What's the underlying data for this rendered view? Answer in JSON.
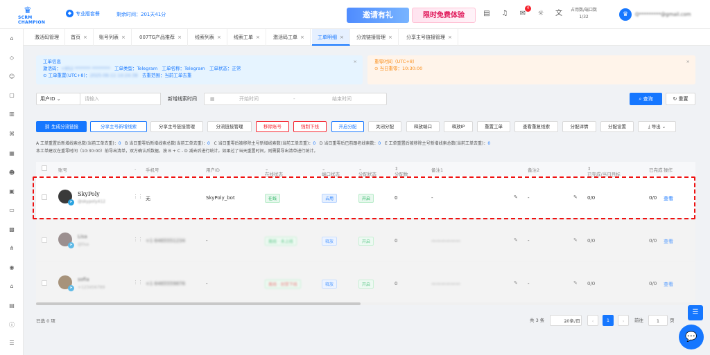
{
  "brand": {
    "line1": "SCRM",
    "line2": "CHAMPION"
  },
  "header": {
    "pro_label": "专业版套餐",
    "remaining_time": "剩余时间：201天41分",
    "banner_invite": "邀请有礼",
    "banner_trial": "限时免费体验",
    "notification_count": "4",
    "usage_label": "占用数/端口数",
    "usage_value": "1/32",
    "user_email": "Q*********@gmail.com"
  },
  "tabs": [
    {
      "label": "激活码管理",
      "closable": false
    },
    {
      "label": "首页",
      "closable": true
    },
    {
      "label": "账号列表",
      "closable": true
    },
    {
      "label": "007TG产品推荐",
      "closable": true
    },
    {
      "label": "线索列表",
      "closable": true
    },
    {
      "label": "线索工单",
      "closable": true
    },
    {
      "label": "激活码工单",
      "closable": true
    },
    {
      "label": "工单明细",
      "closable": true,
      "active": true
    },
    {
      "label": "分流链接管理",
      "closable": true
    },
    {
      "label": "分享主号链接管理",
      "closable": true
    }
  ],
  "info": {
    "title": "工单信息",
    "code_label": "激活码：",
    "type_label": "工单类型：",
    "type_value": "Telegram",
    "name_label": "工单名称：",
    "name_value": "Telegram",
    "status_label": "工单状态：",
    "status_value": "正常",
    "reset_label": "工单重置(UTC+8)：",
    "dedupe_label": "去重范围：",
    "dedupe_value": "当前工单去重"
  },
  "warn": {
    "title": "重零时间（UTC+8）",
    "line": "当日重零：10:30:00"
  },
  "filter": {
    "select_value": "用户ID",
    "input_placeholder": "请输入",
    "time_label": "新增线索时间",
    "start_placeholder": "开始时间",
    "sep": "-",
    "end_placeholder": "结束时间",
    "query": "查询",
    "reset": "重置"
  },
  "actions": [
    {
      "label": "生成分流链接",
      "style": "primary"
    },
    {
      "label": "分享主号新增线索",
      "style": "blue"
    },
    {
      "label": "分享主号链接管理",
      "style": ""
    },
    {
      "label": "分流链接管理",
      "style": ""
    },
    {
      "label": "移除账号",
      "style": "red"
    },
    {
      "label": "强制下线",
      "style": "red"
    },
    {
      "label": "开启分配",
      "style": "blue"
    },
    {
      "label": "关闭分配",
      "style": ""
    },
    {
      "label": "释放端口",
      "style": ""
    },
    {
      "label": "释放IP",
      "style": ""
    },
    {
      "label": "重置工单",
      "style": ""
    },
    {
      "label": "查看重复线索",
      "style": ""
    },
    {
      "label": "分配详情",
      "style": ""
    },
    {
      "label": "分配设置",
      "style": ""
    },
    {
      "label": "导出",
      "style": ""
    }
  ],
  "stats": {
    "a": "A 工单重置后新增线索总数(当前工单去重)：",
    "a_val": "0",
    "b": "B 当日重零后新增线索总数(当前工单去重)：",
    "b_val": "0",
    "c": "C 当日重零后被移除主号新增线索数(当前工单去重)：",
    "c_val": "0",
    "d": "D 当日重零后已前跟老线索数：",
    "d_val": "0",
    "e": "E 工单重置后被移除主号新增线索总数(当前工单去重)：",
    "e_val": "0",
    "note": "本工单建议在重零时间（10:30:00）前导出清单，双方确认后数据，按 B + C - D 减去后进行统计。如果过了当天重置时间，则需要导出清单进行统计。"
  },
  "columns": [
    "账号",
    "手机号",
    "用户ID",
    "在线状态",
    "端口状态",
    "分配状态",
    "分配数",
    "备注1",
    "备注2",
    "已完成/当日目标",
    "已完成",
    "操作"
  ],
  "rows": [
    {
      "name": "SkyPoly",
      "sub": "@skypoly412",
      "phone": "无",
      "userid": "SkyPoly_bot",
      "online": "在线",
      "port": "占用",
      "assign": "开启",
      "count": "0",
      "note1": "-",
      "note2": "-",
      "progress": "0/0",
      "done": "0/0",
      "action": "查看",
      "blurred": false
    },
    {
      "name": "Lisa",
      "sub": "@lisa",
      "phone": "+1 6465551234",
      "userid": "-",
      "online": "离线 · 未上线",
      "port": "释放",
      "assign": "开启",
      "count": "0",
      "note1": "——————",
      "note2": "-",
      "progress": "0/0",
      "done": "0/0",
      "action": "查看",
      "blurred": true
    },
    {
      "name": "sofia",
      "sub": "+123456789",
      "phone": "+1 6465559876",
      "userid": "-",
      "online": "离线 · 封禁下线",
      "port": "释放",
      "assign": "开启",
      "count": "0",
      "note1": "——————",
      "note2": "-",
      "progress": "0/0",
      "done": "0/0",
      "action": "查看",
      "blurred": true
    }
  ],
  "footer": {
    "selected": "已选 0 项",
    "total": "共 3 条",
    "page_size": "20条/页",
    "current_page": "1",
    "goto": "前往",
    "goto_value": "1",
    "page_unit": "页"
  },
  "colors": {
    "primary": "#1677ff",
    "danger": "#f5222d",
    "highlight": "#e11111"
  }
}
